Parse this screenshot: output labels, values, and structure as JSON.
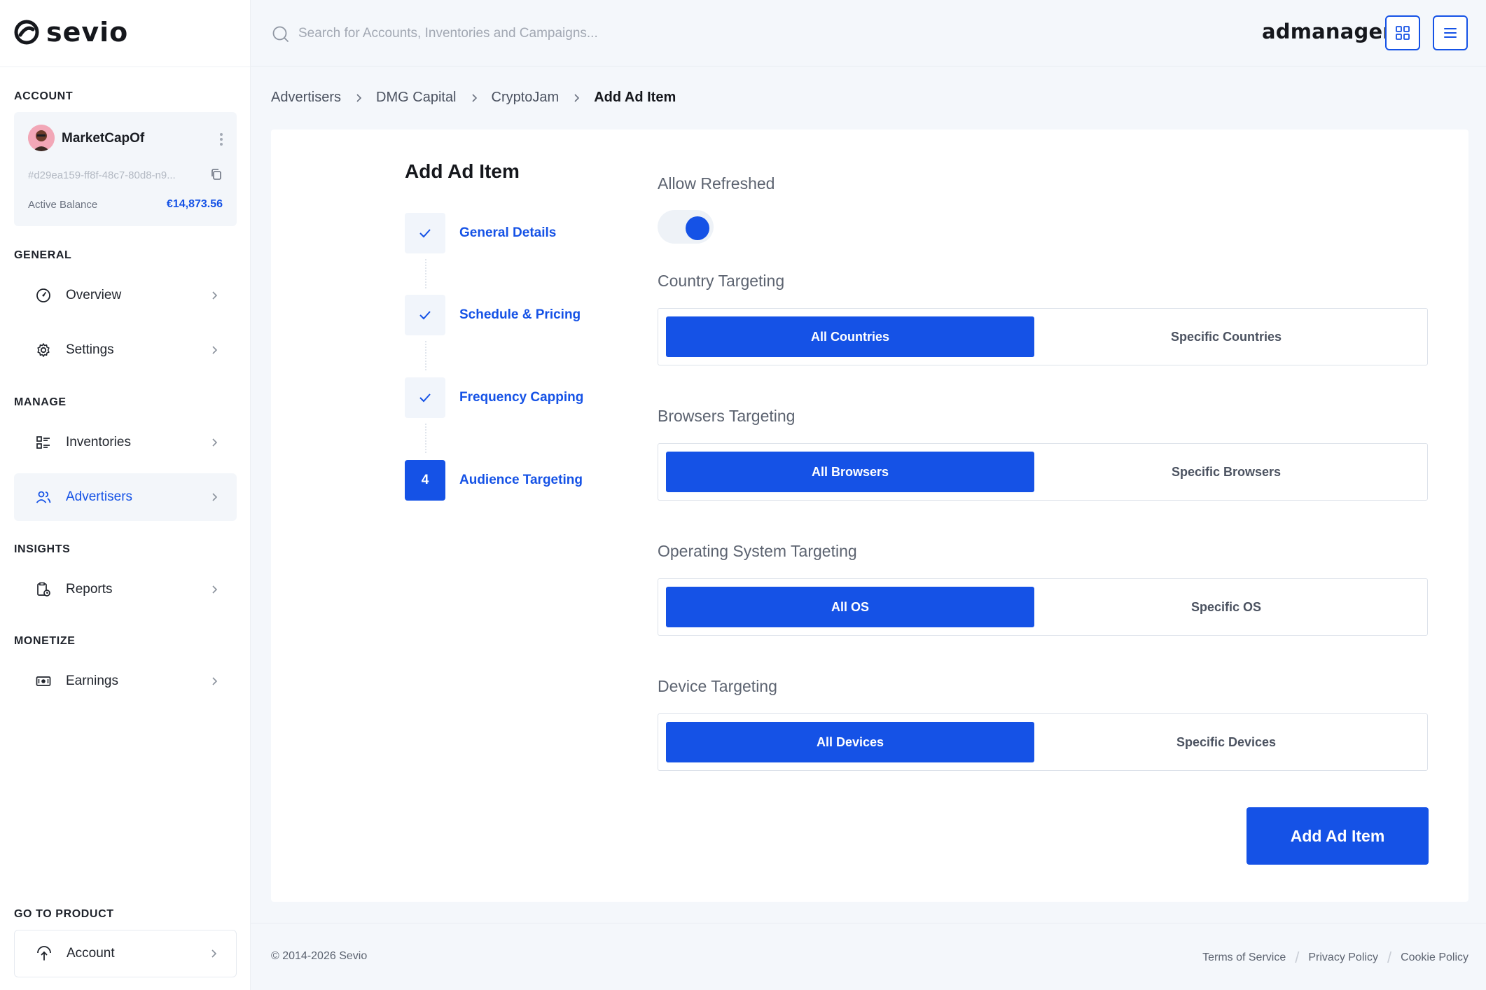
{
  "sidebar": {
    "logo_text": "sevio",
    "sections": {
      "account": "ACCOUNT",
      "general": "GENERAL",
      "manage": "MANAGE",
      "insights": "INSIGHTS",
      "monetize": "MONETIZE",
      "go_to_product": "GO TO PRODUCT"
    },
    "account_card": {
      "name": "MarketCapOf",
      "id": "#d29ea159-ff8f-48c7-80d8-n9...",
      "balance_label": "Active Balance",
      "balance_value": "€14,873.56"
    },
    "items": [
      {
        "label": "Overview",
        "icon": "gauge-icon"
      },
      {
        "label": "Settings",
        "icon": "gear-icon"
      },
      {
        "label": "Inventories",
        "icon": "list-icon"
      },
      {
        "label": "Advertisers",
        "icon": "users-icon",
        "active": true
      },
      {
        "label": "Reports",
        "icon": "report-icon"
      },
      {
        "label": "Earnings",
        "icon": "money-icon"
      }
    ],
    "bottom_item": {
      "label": "Account",
      "icon": "upload-icon"
    }
  },
  "topbar": {
    "search_placeholder": "Search for Accounts, Inventories and Campaigns...",
    "brand": "admanager"
  },
  "breadcrumb": [
    "Advertisers",
    "DMG Capital",
    "CryptoJam",
    "Add Ad Item"
  ],
  "form": {
    "title": "Add Ad Item",
    "steps": [
      {
        "label": "General Details",
        "state": "done"
      },
      {
        "label": "Schedule & Pricing",
        "state": "done"
      },
      {
        "label": "Frequency Capping",
        "state": "done"
      },
      {
        "label": "Audience Targeting",
        "state": "current",
        "number": "4"
      }
    ],
    "allow_refreshed": {
      "label": "Allow Refreshed",
      "enabled": true
    },
    "targeting": [
      {
        "label": "Country Targeting",
        "selected": "All Countries",
        "other": "Specific Countries"
      },
      {
        "label": "Browsers Targeting",
        "selected": "All Browsers",
        "other": "Specific Browsers"
      },
      {
        "label": "Operating System Targeting",
        "selected": "All OS",
        "other": "Specific OS"
      },
      {
        "label": "Device Targeting",
        "selected": "All Devices",
        "other": "Specific Devices"
      }
    ],
    "submit_label": "Add Ad Item"
  },
  "footer": {
    "copyright": "© 2014-2026 Sevio",
    "links": [
      "Terms of Service",
      "Privacy Policy",
      "Cookie Policy"
    ]
  },
  "colors": {
    "accent": "#1552e6",
    "background": "#f4f7fb",
    "sidebar": "#ffffff"
  }
}
